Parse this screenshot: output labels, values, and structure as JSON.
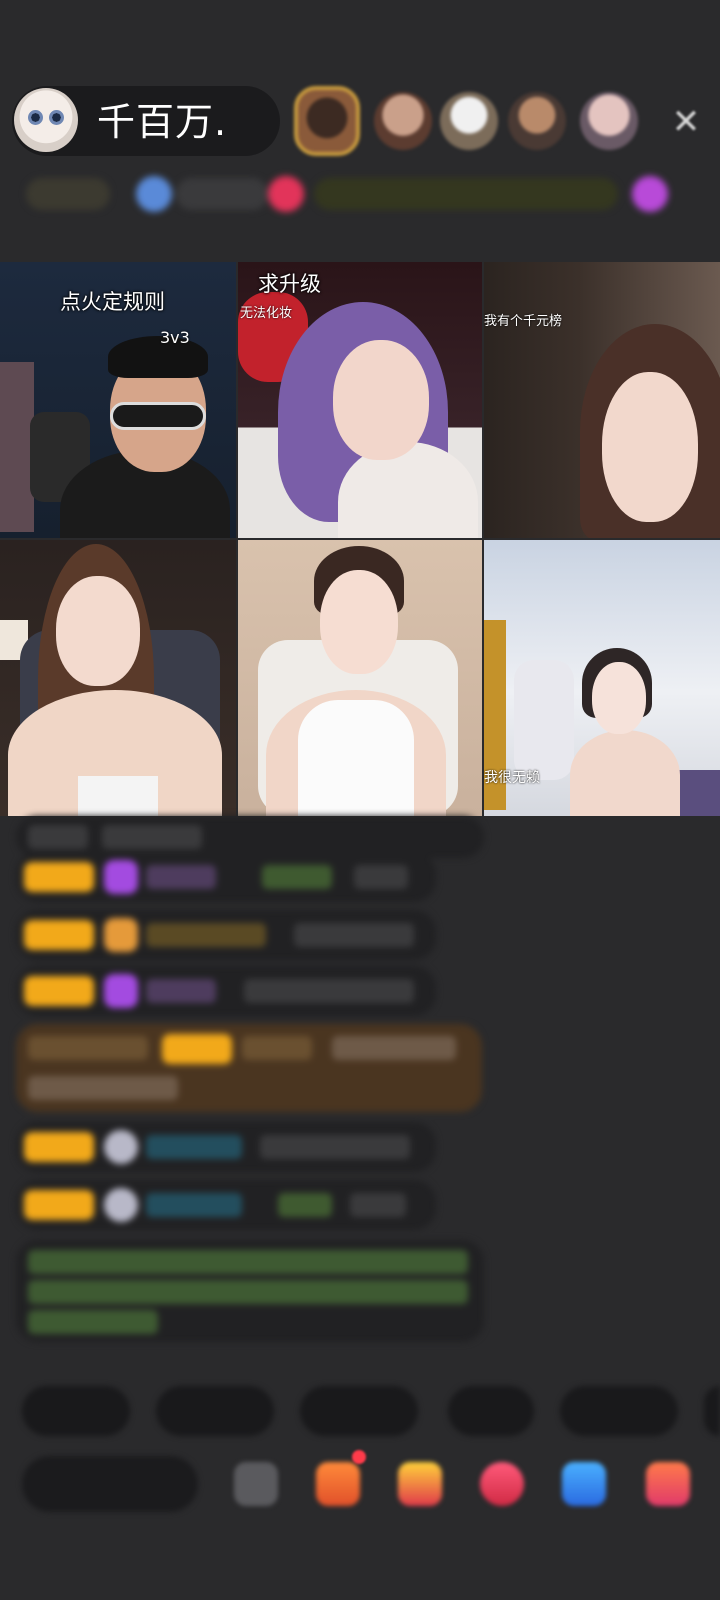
{
  "header": {
    "host_name": "千百万.",
    "close_icon": "close-icon"
  },
  "grid": {
    "tiles": [
      {
        "label": "点火定规则",
        "sub_label": "3v3"
      },
      {
        "label": "求升级",
        "sub_label": "无法化妆"
      },
      {
        "label": "",
        "sub_label": "我有个千元榜"
      },
      {
        "label": "",
        "sub_label": ""
      },
      {
        "label": "",
        "sub_label": ""
      },
      {
        "label": "",
        "sub_label": "我很无赖"
      }
    ]
  },
  "colors": {
    "background": "#2a2a2c",
    "badge_gold": "#f2a91a",
    "gem_purple": "#a34be0",
    "name_green": "#8ac24a",
    "name_teal": "#2aa6c8",
    "notice_bg": "#4a3520",
    "notice_text": "#7ec86a"
  }
}
